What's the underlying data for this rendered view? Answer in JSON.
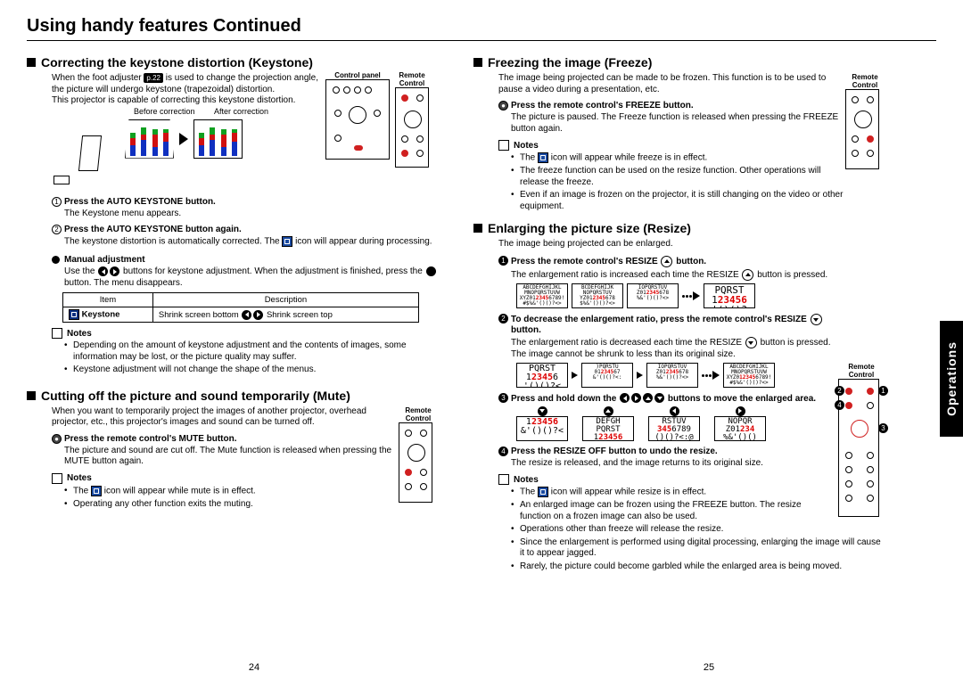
{
  "page_title": "Using handy features Continued",
  "page_left_num": "24",
  "page_right_num": "25",
  "sidebar_tab": "Operations",
  "keystone": {
    "heading": "Correcting the keystone distortion (Keystone)",
    "intro_a": "When the foot adjuster ",
    "ref": "p.22",
    "intro_b": " is used to change the projection angle, the picture will undergo keystone (trapezoidal) distortion.",
    "intro_c": "This projector is capable of correcting this keystone distortion.",
    "before_lbl": "Before correction",
    "after_lbl": "After correction",
    "panel_lbl": "Control panel",
    "remote_lbl": "Remote Control",
    "step1_title": "Press the AUTO KEYSTONE button.",
    "step1_text": "The Keystone menu appears.",
    "step2_title": "Press the AUTO KEYSTONE button again.",
    "step2_text_a": "The keystone distortion is automatically corrected. The ",
    "step2_text_b": " icon will appear during processing.",
    "manual_head": "Manual adjustment",
    "manual_text_a": "Use the ",
    "manual_text_b": " buttons for keystone adjustment. When the adjustment is finished, press the ",
    "manual_text_c": " button. The menu disappears.",
    "table_h1": "Item",
    "table_h2": "Description",
    "table_item": "Keystone",
    "table_desc_a": "Shrink screen bottom ",
    "table_desc_b": " Shrink screen top",
    "notes_head": "Notes",
    "note1": "Depending on the amount of keystone adjustment and the contents of images, some information may be lost, or the picture quality may suffer.",
    "note2": "Keystone adjustment will not change the shape of the menus."
  },
  "mute": {
    "heading": "Cutting off the picture and sound temporarily (Mute)",
    "intro": "When you want to temporarily project the images of another projector, overhead projector, etc., this projector's images and sound can be turned off.",
    "remote_lbl": "Remote Control",
    "step1_title": "Press the remote control's MUTE button.",
    "step1_text": "The picture and sound are cut off. The Mute function is released when pressing the MUTE button again.",
    "notes_head": "Notes",
    "note1_a": "The ",
    "note1_b": " icon will appear while mute is in effect.",
    "note2": "Operating any other function exits the muting."
  },
  "freeze": {
    "heading": "Freezing the image (Freeze)",
    "intro": "The image being projected can be made to be frozen. This function is to be used to pause a video during a presentation, etc.",
    "remote_lbl": "Remote Control",
    "step1_title": "Press the remote control's FREEZE button.",
    "step1_text": "The picture is paused. The Freeze function is released when pressing the FREEZE button again.",
    "notes_head": "Notes",
    "note1_a": "The ",
    "note1_b": " icon will appear while freeze is in effect.",
    "note2": "The freeze function can be used on the resize function. Other operations will release the freeze.",
    "note3": "Even if an image is frozen on the projector, it is still changing on the video or other equipment."
  },
  "resize": {
    "heading": "Enlarging the picture size (Resize)",
    "intro": "The image being projected can be enlarged.",
    "remote_lbl": "Remote Control",
    "step1_title_a": "Press the remote control's RESIZE ",
    "step1_title_b": " button.",
    "step1_text_a": "The enlargement ratio is increased each time the RESIZE ",
    "step1_text_b": " button is pressed.",
    "step2_title_a": "To decrease the enlargement ratio, press the remote control's RESIZE ",
    "step2_title_b": " button.",
    "step2_text_a": "The enlargement ratio is decreased each time the RESIZE ",
    "step2_text_b": " button is pressed.",
    "step2_text2": "The image cannot be shrunk to less than its original size.",
    "step3_title_a": "Press and hold down the ",
    "step3_title_b": " buttons to move the enlarged area.",
    "step4_title": "Press the RESIZE OFF button to undo the resize.",
    "step4_text": "The resize is released, and the image returns to its original size.",
    "notes_head": "Notes",
    "note1_a": "The ",
    "note1_b": " icon will appear while resize is in effect.",
    "note2": "An enlarged image can be frozen using the FREEZE button. The resize function on a frozen image can also be used.",
    "note3": "Operations other than freeze will release the resize.",
    "note4": "Since the enlargement is performed using digital processing, enlarging the image will cause it to appear jagged.",
    "note5": "Rarely, the picture could become garbled while the enlarged area is being moved."
  }
}
